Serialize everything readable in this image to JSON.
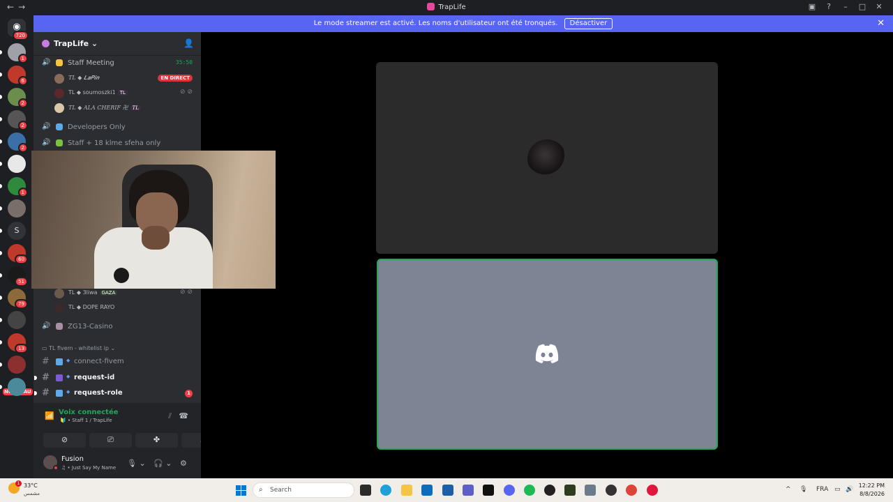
{
  "window": {
    "title": "TrapLife"
  },
  "banner": {
    "text": "Le mode streamer est activé. Les noms d'utilisateur ont été tronqués.",
    "button": "Désactiver"
  },
  "rail": {
    "home_badge": "720",
    "servers": [
      {
        "badge": "1",
        "color": "#a0a0a8"
      },
      {
        "badge": "6",
        "color": "#c0392b"
      },
      {
        "badge": "2",
        "color": "#6b8e4e"
      },
      {
        "badge": "2",
        "color": "#555"
      },
      {
        "badge": "2",
        "color": "#3b6fa8"
      },
      {
        "badge": "",
        "color": "#e8e8e8"
      },
      {
        "badge": "1",
        "color": "#2e8b3e"
      },
      {
        "badge": "",
        "color": "#7a6e6a"
      },
      {
        "badge": "",
        "color": "#313338",
        "letter": "S"
      },
      {
        "badge": "60",
        "color": "#c0392b"
      },
      {
        "badge": "51",
        "color": "#1a1a1a"
      },
      {
        "badge": "79",
        "color": "#8e6a3a"
      },
      {
        "badge": "",
        "color": "#444"
      },
      {
        "badge": "13",
        "color": "#c0392b"
      },
      {
        "badge": "",
        "color": "#8e2f2f"
      },
      {
        "badge": "",
        "color": "#4a8a9a"
      }
    ],
    "new_label": "NOUVEAU"
  },
  "guild": {
    "name": "TrapLife"
  },
  "voice_channels": [
    {
      "name": "Staff Meeting",
      "timer": "35:50",
      "emoji_color": "#f5c542"
    },
    {
      "name": "Developers Only",
      "emoji_color": "#5da9e9"
    },
    {
      "name": "Staff + 18 klme sfeha only",
      "emoji_color": "#7bc043"
    }
  ],
  "meeting_users": [
    {
      "prefix": "TL",
      "name": "𝑳𝒂𝑷𝒊𝒏",
      "live": "EN DIRECT",
      "color": "#8a6a5a"
    },
    {
      "prefix": "TL",
      "name": "soumoszki1",
      "tag": "TL",
      "color": "#5a2a2a"
    },
    {
      "prefix": "TL",
      "name": "ALA CHERIF 卍",
      "tag": "TL",
      "color": "#d8c8a8"
    }
  ],
  "other_users": [
    {
      "prefix": "TL",
      "name": "3liwa",
      "tag": "GAZA",
      "color": "#6a5a4a"
    },
    {
      "prefix": "TL",
      "name": "DOPE RAYO",
      "color": "#3a2a2a"
    }
  ],
  "casino_channel": "ZG13-Casino",
  "category": "TL fivem - whitelist ip",
  "text_channels": [
    {
      "name": "connect-fivem",
      "unread": false,
      "icon_color": "#5da9e9"
    },
    {
      "name": "request-id",
      "unread": true,
      "icon_color": "#7b5cd6"
    },
    {
      "name": "request-role",
      "unread": true,
      "count": "1",
      "icon_color": "#5da9e9"
    }
  ],
  "voice_status": {
    "title": "Voix connectée",
    "subtitle": "Staff 1 / TrapLife"
  },
  "user": {
    "name": "Fusion",
    "activity": "Just Say My Name"
  },
  "taskbar": {
    "temperature": "33°C",
    "condition": "مشمس",
    "weather_badge": "1",
    "search_placeholder": "Search",
    "language": "FRA",
    "time": "12:22 PM",
    "date": "8/8/2026"
  }
}
